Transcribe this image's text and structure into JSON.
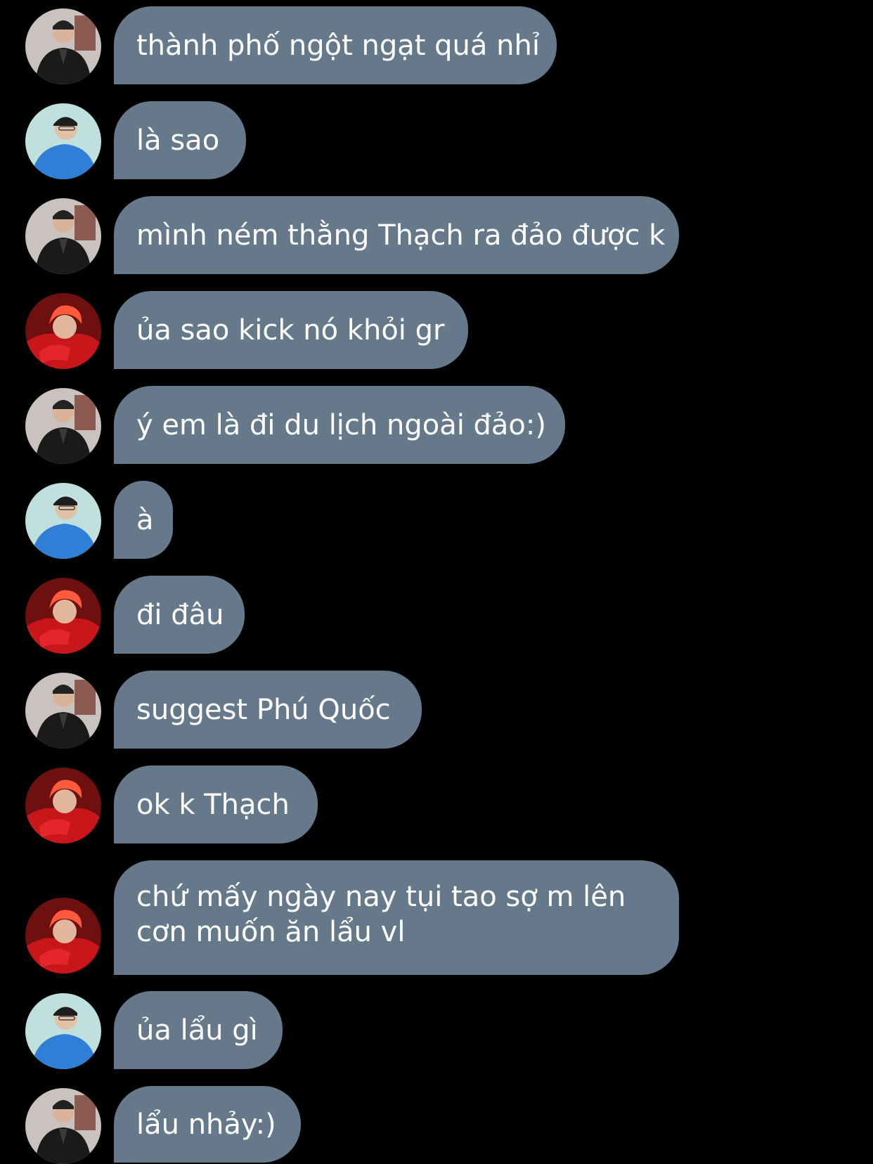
{
  "avatars": {
    "a": "avatar-leather-jacket",
    "b": "avatar-blue-sweater",
    "c": "avatar-red-hair"
  },
  "messages": [
    {
      "avatar": "a",
      "text": "thành phố ngột ngạt quá nhỉ"
    },
    {
      "avatar": "b",
      "text": "là sao"
    },
    {
      "avatar": "a",
      "text": "mình ném thằng Thạch ra đảo được k"
    },
    {
      "avatar": "c",
      "text": "ủa sao kick nó khỏi gr"
    },
    {
      "avatar": "a",
      "text": "ý em là đi du lịch ngoài đảo:)"
    },
    {
      "avatar": "b",
      "text": "à"
    },
    {
      "avatar": "c",
      "text": "đi đâu"
    },
    {
      "avatar": "a",
      "text": "suggest Phú Quốc"
    },
    {
      "avatar": "c",
      "text": "ok k Thạch"
    },
    {
      "avatar": "c",
      "text": "chứ mấy ngày nay tụi tao sợ m lên cơn muốn ăn lẩu vl"
    },
    {
      "avatar": "b",
      "text": "ủa lẩu gì"
    },
    {
      "avatar": "a",
      "text": "lẩu nhảy:)"
    }
  ]
}
